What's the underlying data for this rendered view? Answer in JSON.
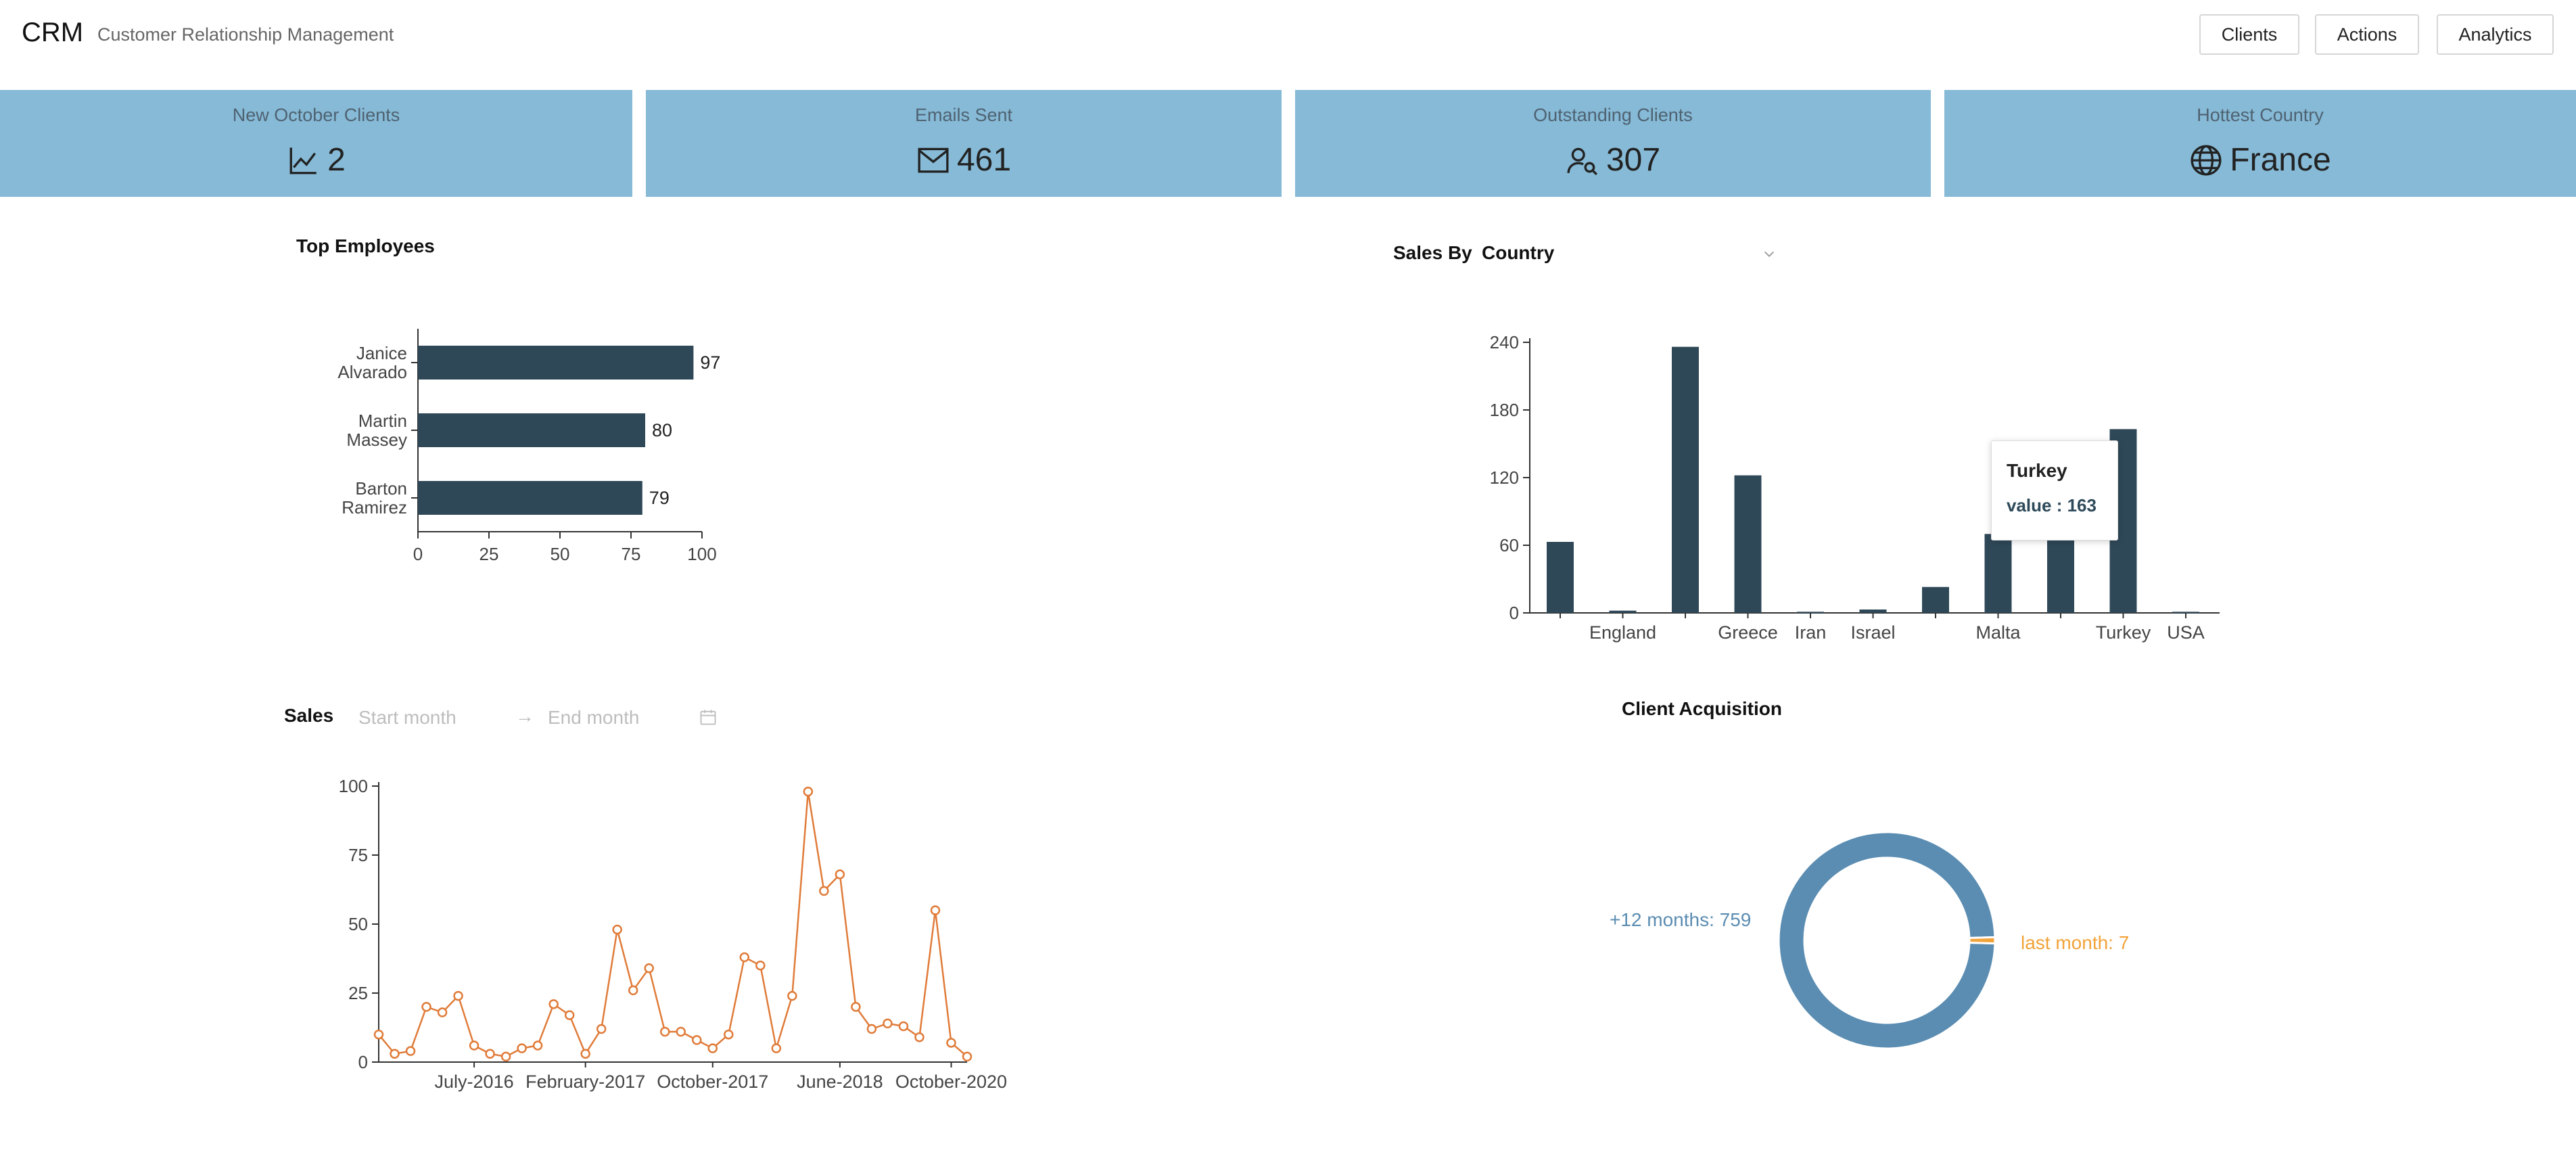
{
  "header": {
    "brand": "CRM",
    "subtitle": "Customer Relationship Management",
    "nav": [
      "Clients",
      "Actions",
      "Analytics"
    ]
  },
  "cards": [
    {
      "label": "New October Clients",
      "value": "2",
      "icon": "line-chart-icon"
    },
    {
      "label": "Emails Sent",
      "value": "461",
      "icon": "mail-icon"
    },
    {
      "label": "Outstanding Clients",
      "value": "307",
      "icon": "user-search-icon"
    },
    {
      "label": "Hottest Country",
      "value": "France",
      "icon": "globe-icon"
    }
  ],
  "top_employees": {
    "title": "Top Employees"
  },
  "sales_by": {
    "label": "Sales By",
    "selected": "Country",
    "tooltip": {
      "name": "Turkey",
      "value_text": "value : 163"
    }
  },
  "sales": {
    "label": "Sales",
    "start_placeholder": "Start month",
    "end_placeholder": "End month",
    "separator": "→"
  },
  "client_acquisition": {
    "title": "Client Acquisition",
    "label_long": "+12 months: 759",
    "label_short": "last month: 7"
  },
  "colors": {
    "card_bg": "#86bad6",
    "bar": "#2f4858",
    "line": "#e07b39",
    "donut_main": "#5b8db2",
    "donut_small": "#f2a33a"
  },
  "chart_data": [
    {
      "type": "bar",
      "orientation": "horizontal",
      "title": "Top Employees",
      "categories": [
        "Janice Alvarado",
        "Martin Massey",
        "Barton Ramirez"
      ],
      "category_lines": [
        [
          "Janice",
          "Alvarado"
        ],
        [
          "Martin",
          "Massey"
        ],
        [
          "Barton",
          "Ramirez"
        ]
      ],
      "values": [
        97,
        80,
        79
      ],
      "xlim": [
        0,
        100
      ],
      "xticks": [
        0,
        25,
        50,
        75,
        100
      ]
    },
    {
      "type": "bar",
      "title": "Sales By Country",
      "categories": [
        "",
        "England",
        "",
        "Greece",
        "Iran",
        "Israel",
        "",
        "Malta",
        "",
        "Turkey",
        "USA"
      ],
      "values": [
        63,
        2,
        236,
        122,
        1,
        3,
        23,
        70,
        70,
        163,
        1
      ],
      "ylim": [
        0,
        240
      ],
      "yticks": [
        0,
        60,
        120,
        180,
        240
      ]
    },
    {
      "type": "line",
      "title": "Sales",
      "values": [
        10,
        3,
        4,
        20,
        18,
        24,
        6,
        3,
        2,
        5,
        6,
        21,
        17,
        3,
        12,
        48,
        26,
        34,
        11,
        11,
        8,
        5,
        10,
        38,
        35,
        5,
        24,
        98,
        62,
        68,
        20,
        12,
        14,
        13,
        9,
        55,
        7,
        2
      ],
      "xtick_labels": [
        {
          "index": 6,
          "label": "July-2016"
        },
        {
          "index": 13,
          "label": "February-2017"
        },
        {
          "index": 21,
          "label": "October-2017"
        },
        {
          "index": 29,
          "label": "June-2018"
        },
        {
          "index": 36,
          "label": "October-2020"
        }
      ],
      "ylim": [
        0,
        100
      ],
      "yticks": [
        0,
        25,
        50,
        75,
        100
      ]
    },
    {
      "type": "pie",
      "title": "Client Acquisition",
      "slices": [
        {
          "label": "+12 months",
          "value": 759
        },
        {
          "label": "last month",
          "value": 7
        }
      ]
    }
  ]
}
